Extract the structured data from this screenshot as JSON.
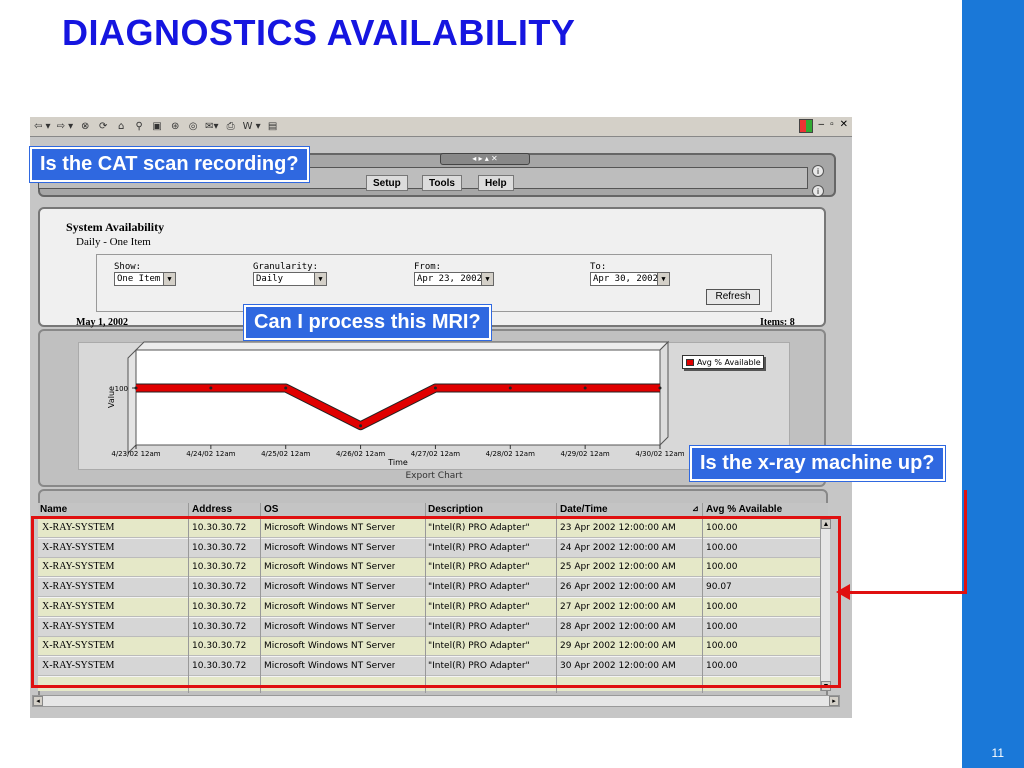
{
  "slide": {
    "title": "DIAGNOSTICS AVAILABILITY",
    "page_number": "11"
  },
  "colors": {
    "title": "#1515e0",
    "sidebar": "#1a78d8",
    "callout": "#2f68e0",
    "highlight": "#e01010"
  },
  "browser_toolbar": {
    "icons": [
      "back-arrow-icon",
      "forward-arrow-icon",
      "stop-icon",
      "refresh-icon",
      "home-icon",
      "search-icon",
      "favorites-icon",
      "history-icon",
      "media-icon",
      "mail-icon",
      "print-icon",
      "edit-icon",
      "discuss-icon"
    ],
    "glyphs": [
      "⇦ ▾",
      "⇨ ▾",
      "⊗",
      "⟳",
      "⌂",
      "⚲",
      "▣",
      "⊛",
      "◎",
      "✉▾",
      "⎙",
      "W ▾",
      "▤"
    ],
    "window_controls": [
      "–",
      "▫",
      "✕"
    ]
  },
  "menu": {
    "items": [
      "Setup",
      "Tools",
      "Help"
    ]
  },
  "report": {
    "title": "System Availability",
    "subtitle": "Daily - One Item",
    "show_label": "Show:",
    "show_value": "One Item",
    "granularity_label": "Granularity:",
    "granularity_value": "Daily",
    "from_label": "From:",
    "from_value": "Apr 23, 2002",
    "to_label": "To:",
    "to_value": "Apr 30, 2002",
    "refresh_label": "Refresh",
    "date": "May 1, 2002",
    "items": "Items: 8"
  },
  "chart_data": {
    "type": "line",
    "x": [
      "4/23/02 12am",
      "4/24/02 12am",
      "4/25/02 12am",
      "4/26/02 12am",
      "4/27/02 12am",
      "4/28/02 12am",
      "4/29/02 12am",
      "4/30/02 12am"
    ],
    "series": [
      {
        "name": "Avg % Available",
        "values": [
          100,
          100,
          100,
          90.07,
          100,
          100,
          100,
          100
        ]
      }
    ],
    "xlabel": "Time",
    "ylabel": "Value",
    "y_tick": "100",
    "legend_position": "top-right",
    "series_color": "#e00000",
    "export_label": "Export Chart"
  },
  "table": {
    "columns": [
      "Name",
      "Address",
      "OS",
      "Description",
      "Date/Time",
      "Avg % Available"
    ],
    "rows": [
      [
        "X-RAY-SYSTEM",
        "10.30.30.72",
        "Microsoft Windows NT Server",
        "\"Intel(R) PRO Adapter\"",
        "23 Apr 2002 12:00:00 AM",
        "100.00"
      ],
      [
        "X-RAY-SYSTEM",
        "10.30.30.72",
        "Microsoft Windows NT Server",
        "\"Intel(R) PRO Adapter\"",
        "24 Apr 2002 12:00:00 AM",
        "100.00"
      ],
      [
        "X-RAY-SYSTEM",
        "10.30.30.72",
        "Microsoft Windows NT Server",
        "\"Intel(R) PRO Adapter\"",
        "25 Apr 2002 12:00:00 AM",
        "100.00"
      ],
      [
        "X-RAY-SYSTEM",
        "10.30.30.72",
        "Microsoft Windows NT Server",
        "\"Intel(R) PRO Adapter\"",
        "26 Apr 2002 12:00:00 AM",
        "90.07"
      ],
      [
        "X-RAY-SYSTEM",
        "10.30.30.72",
        "Microsoft Windows NT Server",
        "\"Intel(R) PRO Adapter\"",
        "27 Apr 2002 12:00:00 AM",
        "100.00"
      ],
      [
        "X-RAY-SYSTEM",
        "10.30.30.72",
        "Microsoft Windows NT Server",
        "\"Intel(R) PRO Adapter\"",
        "28 Apr 2002 12:00:00 AM",
        "100.00"
      ],
      [
        "X-RAY-SYSTEM",
        "10.30.30.72",
        "Microsoft Windows NT Server",
        "\"Intel(R) PRO Adapter\"",
        "29 Apr 2002 12:00:00 AM",
        "100.00"
      ],
      [
        "X-RAY-SYSTEM",
        "10.30.30.72",
        "Microsoft Windows NT Server",
        "\"Intel(R) PRO Adapter\"",
        "30 Apr 2002 12:00:00 AM",
        "100.00"
      ]
    ]
  },
  "callouts": {
    "cat_scan": "Is the CAT scan recording?",
    "mri": "Can I process this MRI?",
    "xray": "Is the x-ray machine up?"
  }
}
